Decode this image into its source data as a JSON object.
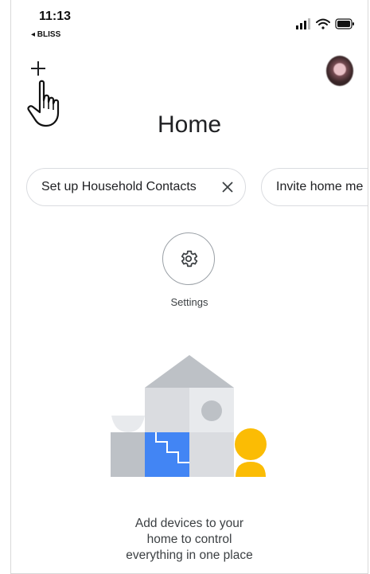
{
  "status_bar": {
    "time": "11:13",
    "back_label": "◂ BLISS"
  },
  "header": {
    "add_icon": "plus-icon",
    "pointer_icon": "hand-pointer-icon",
    "avatar_icon": "account-avatar",
    "title": "Home"
  },
  "chips": [
    {
      "label": "Set up Household Contacts",
      "dismiss_icon": "close-icon"
    },
    {
      "label": "Invite home me"
    }
  ],
  "settings": {
    "icon": "gear-icon",
    "label": "Settings"
  },
  "empty_state": {
    "illustration": "house-illustration",
    "lines": [
      "Add devices to your",
      "home to control",
      "everything in one place"
    ]
  },
  "colors": {
    "text_primary": "#202124",
    "chip_border": "#dadce0",
    "accent_blue": "#4285f4",
    "accent_yellow": "#fbbc04",
    "illustration_gray": "#bdc1c6"
  }
}
